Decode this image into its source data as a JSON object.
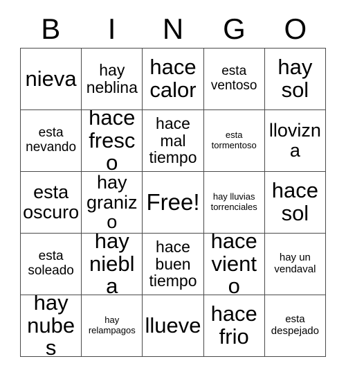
{
  "card": {
    "headers": [
      "B",
      "I",
      "N",
      "G",
      "O"
    ],
    "rows": [
      [
        {
          "text": "nieva",
          "size": "xxl"
        },
        {
          "text": "hay neblina",
          "size": "lg"
        },
        {
          "text": "hace calor",
          "size": "xxl"
        },
        {
          "text": "esta ventoso",
          "size": "md"
        },
        {
          "text": "hay sol",
          "size": "xxl"
        }
      ],
      [
        {
          "text": "esta nevando",
          "size": "md"
        },
        {
          "text": "hace fresco",
          "size": "xxl"
        },
        {
          "text": "hace mal tiempo",
          "size": "lg"
        },
        {
          "text": "esta tormentoso",
          "size": "xs"
        },
        {
          "text": "llovizna",
          "size": "xl"
        }
      ],
      [
        {
          "text": "esta oscuro",
          "size": "xl"
        },
        {
          "text": "hay granizo",
          "size": "xl"
        },
        {
          "text": "Free!",
          "size": "free"
        },
        {
          "text": "hay lluvias torrenciales",
          "size": "xs"
        },
        {
          "text": "hace sol",
          "size": "xxl"
        }
      ],
      [
        {
          "text": "esta soleado",
          "size": "md"
        },
        {
          "text": "hay niebla",
          "size": "xxl"
        },
        {
          "text": "hace buen tiempo",
          "size": "lg"
        },
        {
          "text": "hace viento",
          "size": "xxl"
        },
        {
          "text": "hay un vendaval",
          "size": "sm"
        }
      ],
      [
        {
          "text": "hay nubes",
          "size": "xxl"
        },
        {
          "text": "hay relampagos",
          "size": "xs"
        },
        {
          "text": "llueve",
          "size": "xxl"
        },
        {
          "text": "hace frio",
          "size": "xxl"
        },
        {
          "text": "esta despejado",
          "size": "sm"
        }
      ]
    ],
    "colors": {
      "background": "#ffffff",
      "text": "#000000",
      "border": "#4a4a4a"
    }
  }
}
